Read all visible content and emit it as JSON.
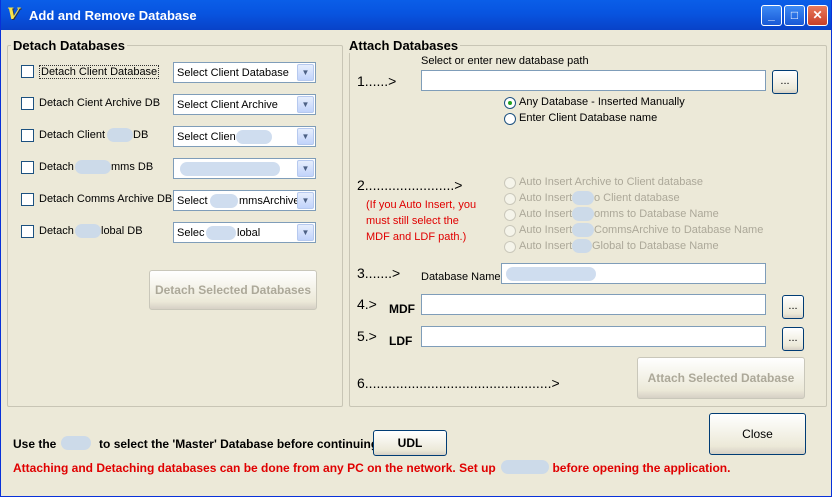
{
  "window": {
    "title": "Add and Remove Database"
  },
  "detach": {
    "title": "Detach Databases",
    "rows": [
      {
        "label": "Detach Client Database",
        "select": "Select Client Database"
      },
      {
        "label": "Detach Cient Archive DB",
        "select": "Select Client Archive"
      },
      {
        "label": "Detach Client",
        "label_tail": "DB",
        "select": "Select Clien"
      },
      {
        "label": "Detach",
        "label_tail": "mms DB",
        "select": ""
      },
      {
        "label": "Detach Comms Archive DB",
        "select": "Select",
        "select_tail": "mmsArchive"
      },
      {
        "label": "Detach",
        "label_tail": "lobal DB",
        "select": "Selec",
        "select_tail": "lobal"
      }
    ],
    "button": "Detach Selected Databases"
  },
  "attach": {
    "title": "Attach Databases",
    "path_caption": "Select or enter new database path",
    "browse": "...",
    "steps": {
      "s1": "1......>",
      "s2": "2.......................>",
      "s3": "3.......>",
      "s4": "4.>",
      "s5": "5.>",
      "s6": "6................................................>"
    },
    "radio_manual": "Any Database - Inserted Manually",
    "radio_client": "Enter Client Database name",
    "auto_options": [
      {
        "text": "Auto Insert Archive to Client database"
      },
      {
        "text": "Auto Insert",
        "tail": "o Client database"
      },
      {
        "text": "Auto Insert",
        "tail": "omms to Database Name"
      },
      {
        "text": "Auto Insert",
        "tail": "CommsArchive to Database Name"
      },
      {
        "text": "Auto Insert",
        "tail": "Global to Database Name"
      }
    ],
    "note": [
      "(If you Auto Insert, you",
      "must still select the",
      "MDF and LDF path.)"
    ],
    "db_name_label": "Database Name",
    "mdf_label": "MDF",
    "ldf_label": "LDF",
    "button": "Attach Selected Database"
  },
  "footer": {
    "udl_text_a": "Use the",
    "udl_text_b": "to select the 'Master' Database before continuing",
    "udl_button": "UDL",
    "close_button": "Close",
    "warning_a": "Attaching and Detaching databases can be done from any PC on the network. Set up",
    "warning_b": "before opening the application."
  }
}
